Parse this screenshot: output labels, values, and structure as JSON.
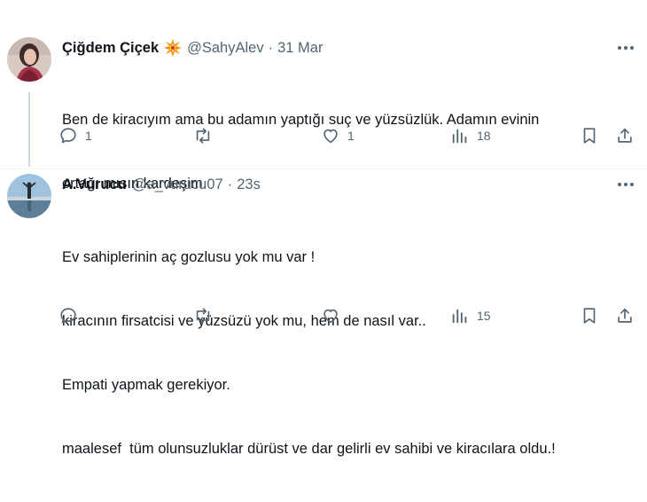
{
  "tweets": [
    {
      "display_name": "Çiğdem Çiçek",
      "badge_icon": "explosion-emoji-icon",
      "handle": "@SahyAlev",
      "separator": "·",
      "time": "31 Mar",
      "text_lines": [
        "Ben de kiracıyım ama bu adamın yaptığı suç ve yüzsüzlük. Adamın evinin",
        "ortağı mısın kardeşim."
      ],
      "actions": {
        "reply": "1",
        "retweet": "",
        "like": "1",
        "views": "18"
      }
    },
    {
      "display_name": "A.Vurucu",
      "handle": "@a_vurucu07",
      "separator": "·",
      "time": "23s",
      "text_lines": [
        "Ev sahiplerinin aç gozlusu yok mu var !",
        "kiracının firsatcisi ve yüzsüzü yok mu, hem de nasıl var..",
        "Empati yapmak gerekiyor.",
        "maalesef  tüm olunsuzluklar dürüst ve dar gelirli ev sahibi ve kiracılara oldu.!"
      ],
      "actions": {
        "reply": "",
        "retweet": "",
        "like": "",
        "views": "15"
      }
    }
  ],
  "colors": {
    "text": "#0f1419",
    "secondary": "#536471",
    "divider": "#eff3f4",
    "thread_line": "#cfd9de"
  }
}
